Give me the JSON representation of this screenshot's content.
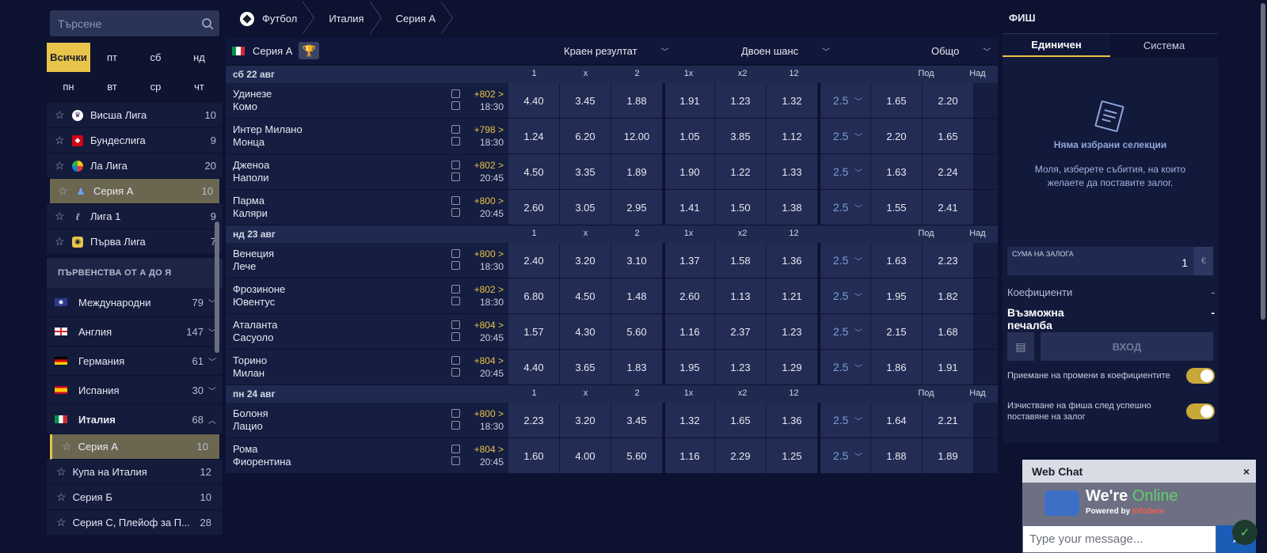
{
  "search": {
    "placeholder": "Търсене"
  },
  "days": [
    "Всички",
    "пт",
    "сб",
    "нд",
    "пн",
    "вт",
    "ср",
    "чт"
  ],
  "top_leagues": [
    {
      "name": "Висша Лига",
      "count": "10"
    },
    {
      "name": "Бундеслига",
      "count": "9"
    },
    {
      "name": "Ла Лига",
      "count": "20"
    },
    {
      "name": "Серия А",
      "count": "10"
    },
    {
      "name": "Лига 1",
      "count": "9"
    },
    {
      "name": "Първа Лига",
      "count": "7"
    }
  ],
  "az_header": "ПЪРВЕНСТВА ОТ А ДО Я",
  "countries": [
    {
      "name": "Международни",
      "count": "79"
    },
    {
      "name": "Англия",
      "count": "147"
    },
    {
      "name": "Германия",
      "count": "61"
    },
    {
      "name": "Испания",
      "count": "30"
    },
    {
      "name": "Италия",
      "count": "68"
    }
  ],
  "italy_leagues": [
    {
      "name": "Серия А",
      "count": "10"
    },
    {
      "name": "Купа на Италия",
      "count": "12"
    },
    {
      "name": "Серия Б",
      "count": "10"
    },
    {
      "name": "Серия С, Плейоф за П...",
      "count": "28"
    }
  ],
  "breadcrumb": [
    "Футбол",
    "Италия",
    "Серия А"
  ],
  "league_title": "Серия А",
  "markets": [
    "Краен резултат",
    "Двоен шанс",
    "Общо"
  ],
  "columns": [
    "1",
    "x",
    "2",
    "1x",
    "x2",
    "12",
    "Под",
    "Над"
  ],
  "groups": [
    {
      "date": "сб 22 авг",
      "matches": [
        {
          "home": "Удинезе",
          "away": "Комо",
          "plus": "+802 >",
          "time": "18:30",
          "odds": [
            "4.40",
            "3.45",
            "1.88",
            "1.91",
            "1.23",
            "1.32"
          ],
          "line": "2.5",
          "under": "1.65",
          "over": "2.20"
        },
        {
          "home": "Интер Милано",
          "away": "Монца",
          "plus": "+798 >",
          "time": "18:30",
          "odds": [
            "1.24",
            "6.20",
            "12.00",
            "1.05",
            "3.85",
            "1.12"
          ],
          "line": "2.5",
          "under": "2.20",
          "over": "1.65"
        },
        {
          "home": "Дженоа",
          "away": "Наполи",
          "plus": "+802 >",
          "time": "20:45",
          "odds": [
            "4.50",
            "3.35",
            "1.89",
            "1.90",
            "1.22",
            "1.33"
          ],
          "line": "2.5",
          "under": "1.63",
          "over": "2.24"
        },
        {
          "home": "Парма",
          "away": "Каляри",
          "plus": "+800 >",
          "time": "20:45",
          "odds": [
            "2.60",
            "3.05",
            "2.95",
            "1.41",
            "1.50",
            "1.38"
          ],
          "line": "2.5",
          "under": "1.55",
          "over": "2.41"
        }
      ]
    },
    {
      "date": "нд 23 авг",
      "matches": [
        {
          "home": "Венеция",
          "away": "Лече",
          "plus": "+800 >",
          "time": "18:30",
          "odds": [
            "2.40",
            "3.20",
            "3.10",
            "1.37",
            "1.58",
            "1.36"
          ],
          "line": "2.5",
          "under": "1.63",
          "over": "2.23"
        },
        {
          "home": "Фрозиноне",
          "away": "Ювентус",
          "plus": "+802 >",
          "time": "18:30",
          "odds": [
            "6.80",
            "4.50",
            "1.48",
            "2.60",
            "1.13",
            "1.21"
          ],
          "line": "2.5",
          "under": "1.95",
          "over": "1.82"
        },
        {
          "home": "Аталанта",
          "away": "Сасуоло",
          "plus": "+804 >",
          "time": "20:45",
          "odds": [
            "1.57",
            "4.30",
            "5.60",
            "1.16",
            "2.37",
            "1.23"
          ],
          "line": "2.5",
          "under": "2.15",
          "over": "1.68"
        },
        {
          "home": "Торино",
          "away": "Милан",
          "plus": "+804 >",
          "time": "20:45",
          "odds": [
            "4.40",
            "3.65",
            "1.83",
            "1.95",
            "1.23",
            "1.29"
          ],
          "line": "2.5",
          "under": "1.86",
          "over": "1.91"
        }
      ]
    },
    {
      "date": "пн 24 авг",
      "matches": [
        {
          "home": "Болоня",
          "away": "Лацио",
          "plus": "+800 >",
          "time": "18:30",
          "odds": [
            "2.23",
            "3.20",
            "3.45",
            "1.32",
            "1.65",
            "1.36"
          ],
          "line": "2.5",
          "under": "1.64",
          "over": "2.21"
        },
        {
          "home": "Рома",
          "away": "Фиорентина",
          "plus": "+804 >",
          "time": "20:45",
          "odds": [
            "1.60",
            "4.00",
            "5.60",
            "1.16",
            "2.29",
            "1.25"
          ],
          "line": "2.5",
          "under": "1.88",
          "over": "1.89"
        }
      ]
    }
  ],
  "slip": {
    "title": "ФИШ",
    "tabs": [
      "Единичен",
      "Система"
    ],
    "empty_title": "Няма избрани селекции",
    "empty_desc": "Моля, изберете събития, на които желаете да поставите залог.",
    "stake_label": "СУМА НА ЗАЛОГА",
    "stake_value": "1",
    "currency": "€",
    "coef_label": "Коефициенти",
    "coef_value": "-",
    "win_label": "Възможна печалба",
    "win_value": "-",
    "login_label": "ВХОД",
    "accept_label": "Приемане на промени в коефициентите",
    "clear_label": "Изчистване на фиша след успешно поставяне на залог"
  },
  "chat": {
    "title": "Web Chat",
    "close": "×",
    "online_prefix": "We're ",
    "online_word": "Online",
    "powered_prefix": "Powered by ",
    "powered_brand": "InfoServ",
    "placeholder": "Type your message..."
  }
}
